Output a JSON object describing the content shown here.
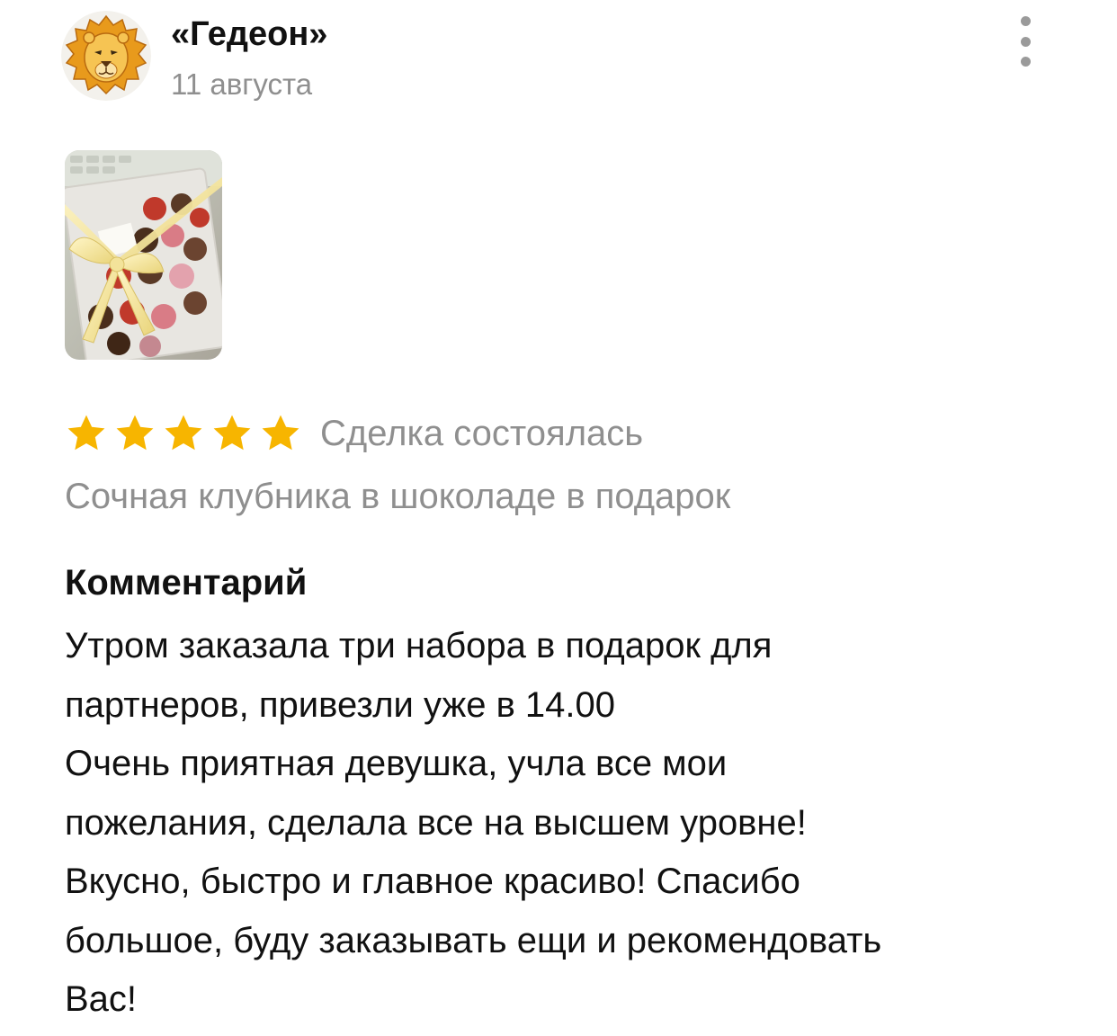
{
  "review": {
    "author": {
      "name": "«Гедеон»",
      "avatar_icon": "lion-avatar"
    },
    "date": "11 августа",
    "menu_icon": "more-vertical-icon",
    "photo": {
      "description_icon": "photo-thumbnail"
    },
    "rating": {
      "stars": 5,
      "max_stars": 5,
      "star_color": "#f7b500"
    },
    "deal_status": "Сделка состоялась",
    "product_title": "Сочная клубника в шоколаде в подарок",
    "comment": {
      "heading": "Комментарий",
      "lines": [
        "Утром заказала три набора в подарок для",
        "партнеров, привезли уже в 14.00",
        "Очень приятная девушка, учла все мои",
        "пожелания, сделала все на высшем уровне!",
        "Вкусно, быстро и главное красиво! Спасибо",
        "большое, буду заказывать ещи и рекомендовать",
        "Вас!"
      ]
    }
  }
}
